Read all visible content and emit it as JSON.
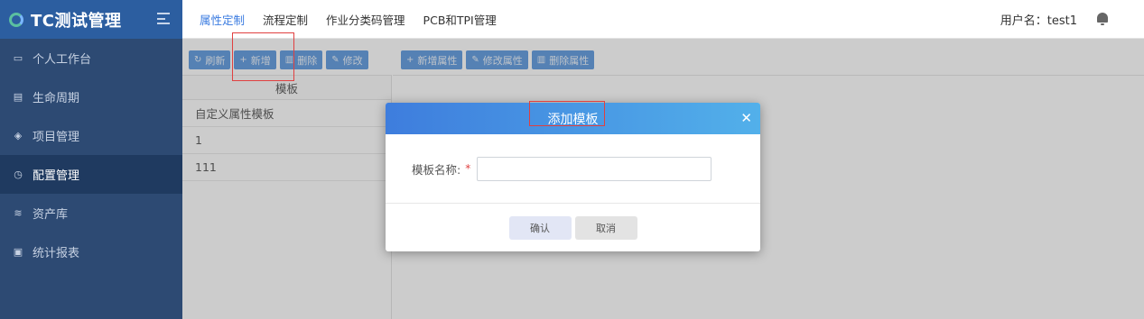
{
  "app": {
    "title": "TC测试管理"
  },
  "sidebar": {
    "items": [
      {
        "label": "个人工作台",
        "icon": "monitor-icon",
        "active": false
      },
      {
        "label": "生命周期",
        "icon": "clipboard-icon",
        "active": false
      },
      {
        "label": "项目管理",
        "icon": "layers-icon",
        "active": false
      },
      {
        "label": "配置管理",
        "icon": "clock-icon",
        "active": true
      },
      {
        "label": "资产库",
        "icon": "database-icon",
        "active": false
      },
      {
        "label": "统计报表",
        "icon": "report-icon",
        "active": false
      }
    ]
  },
  "topbar": {
    "tabs": [
      {
        "label": "属性定制",
        "active": true
      },
      {
        "label": "流程定制",
        "active": false
      },
      {
        "label": "作业分类码管理",
        "active": false
      },
      {
        "label": "PCB和TPI管理",
        "active": false
      }
    ],
    "user_label": "用户名：test1"
  },
  "toolbar": {
    "refresh": "刷新",
    "add": "新增",
    "delete": "删除",
    "edit": "修改",
    "add_attr": "新增属性",
    "edit_attr": "修改属性",
    "delete_attr": "删除属性"
  },
  "template_list": {
    "header": "模板",
    "rows": [
      "自定义属性模板",
      "1",
      "111"
    ]
  },
  "modal": {
    "title": "添加模板",
    "field_label": "模板名称:",
    "required_mark": "*",
    "field_value": "",
    "confirm": "确认",
    "cancel": "取消"
  },
  "colors": {
    "sidebar_bg": "#2d4a73",
    "accent": "#3a7be0",
    "button_bg": "#3f86d8",
    "highlight": "#e04040"
  }
}
